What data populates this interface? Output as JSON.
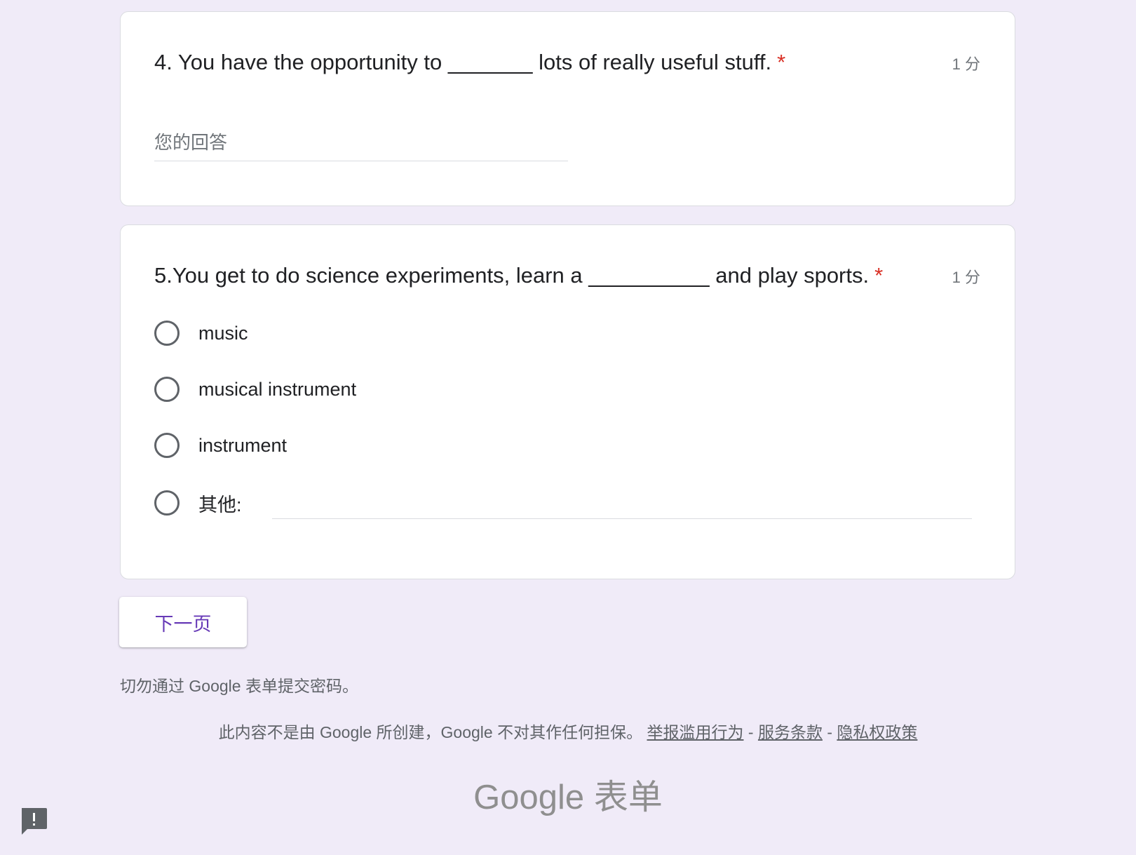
{
  "questions": [
    {
      "title": "4. You have the opportunity to _______ lots of really useful stuff.",
      "required_mark": "*",
      "points": "1 分",
      "answer_placeholder": "您的回答"
    },
    {
      "title": "5.You get to do science experiments, learn a __________ and play sports.",
      "required_mark": "*",
      "points": "1 分",
      "options": [
        "music",
        "musical instrument",
        "instrument",
        "其他:"
      ]
    }
  ],
  "next_button": "下一页",
  "warning": "切勿通过 Google 表单提交密码。",
  "footer": {
    "disclaimer": "此内容不是由 Google 所创建，Google 不对其作任何担保。",
    "report_link": "举报滥用行为",
    "terms_link": "服务条款",
    "privacy_link": "隐私权政策",
    "separator": "-"
  },
  "brand": {
    "google": "Google",
    "forms": "表单"
  },
  "icons": {
    "feedback": "feedback-icon"
  },
  "colors": {
    "background": "#f0ebf8",
    "accent": "#673ab7",
    "required": "#d93025"
  }
}
